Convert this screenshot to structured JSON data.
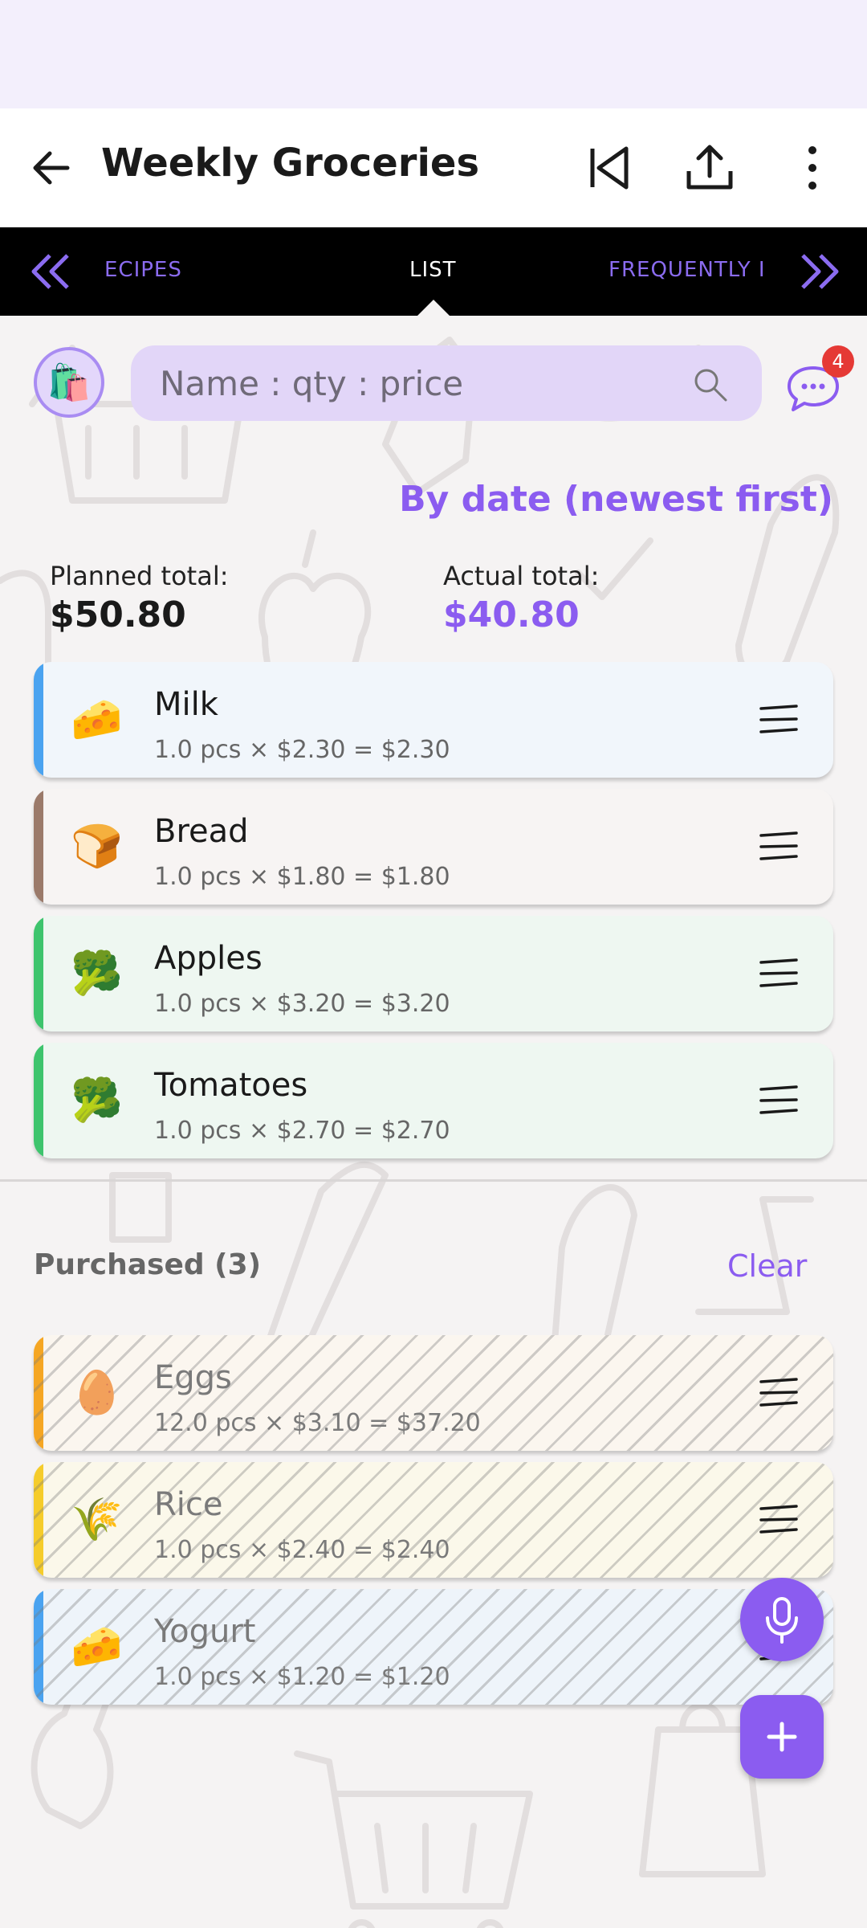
{
  "app": {
    "title": "Weekly Groceries"
  },
  "tabs": {
    "prev": "ECIPES",
    "active": "LIST",
    "next": "FREQUENTLY I"
  },
  "search": {
    "placeholder": "Name : qty : price"
  },
  "chat": {
    "badge_count": "4"
  },
  "sort": {
    "label": "By date (newest first)"
  },
  "totals": {
    "planned_label": "Planned total:",
    "planned_value": "$50.80",
    "actual_label": "Actual total:",
    "actual_value": "$40.80"
  },
  "items": [
    {
      "name": "Milk",
      "detail": "1.0 pcs × $2.30 = $2.30",
      "emoji": "🧀",
      "color": "#4aa3f0",
      "bg": "#f1f6fb"
    },
    {
      "name": "Bread",
      "detail": "1.0 pcs × $1.80 = $1.80",
      "emoji": "🍞",
      "color": "#9b7a6a",
      "bg": "#f7f4f3"
    },
    {
      "name": "Apples",
      "detail": "1.0 pcs × $3.20 = $3.20",
      "emoji": "🥦",
      "color": "#3ec46d",
      "bg": "#eef7f1"
    },
    {
      "name": "Tomatoes",
      "detail": "1.0 pcs × $2.70 = $2.70",
      "emoji": "🥦",
      "color": "#3ec46d",
      "bg": "#eef7f1"
    }
  ],
  "purchased": {
    "title": "Purchased (3)",
    "clear_label": "Clear",
    "items": [
      {
        "name": "Eggs",
        "detail": "12.0 pcs × $3.10 = $37.20",
        "emoji": "🥚",
        "color": "#f5a623",
        "bg": "#fbf6ef"
      },
      {
        "name": "Rice",
        "detail": "1.0 pcs × $2.40 = $2.40",
        "emoji": "🌾",
        "color": "#f5cc2b",
        "bg": "#fbf8ea"
      },
      {
        "name": "Yogurt",
        "detail": "1.0 pcs × $1.20 = $1.20",
        "emoji": "🧀",
        "color": "#4aa3f0",
        "bg": "#eef4fa"
      }
    ]
  },
  "icons": {
    "back": "arrow-left-icon",
    "first_page": "skip-first-icon",
    "share": "share-icon",
    "more": "more-vert-icon",
    "search": "search-icon",
    "chat": "chat-icon",
    "drag": "drag-handle-icon",
    "mic": "mic-icon",
    "add": "plus-icon"
  },
  "colors": {
    "accent": "#8b5cf0",
    "tab_bg": "#000000",
    "badge": "#e53935"
  }
}
